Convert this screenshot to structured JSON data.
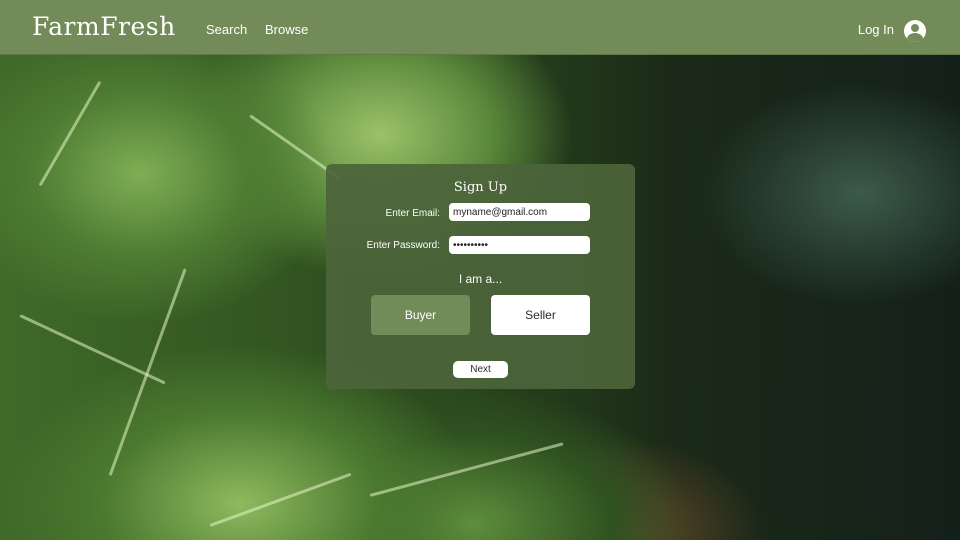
{
  "app": {
    "logo": "FarmFresh"
  },
  "nav": {
    "links": [
      {
        "label": "Search"
      },
      {
        "label": "Browse"
      }
    ],
    "login_label": "Log In",
    "user_icon": "account-circle-icon"
  },
  "signup": {
    "title": "Sign Up",
    "email_label": "Enter Email:",
    "email_value": "myname@gmail.com",
    "password_label": "Enter Password:",
    "password_value": "••••••••••",
    "role_prompt": "I am a...",
    "roles": [
      {
        "label": "Buyer",
        "selected": true
      },
      {
        "label": "Seller",
        "selected": false
      }
    ],
    "next_label": "Next"
  },
  "colors": {
    "navbar": "#728b59",
    "card": "#4c643a",
    "selected_role": "#728b59",
    "text_on_dark": "#ffffff"
  }
}
